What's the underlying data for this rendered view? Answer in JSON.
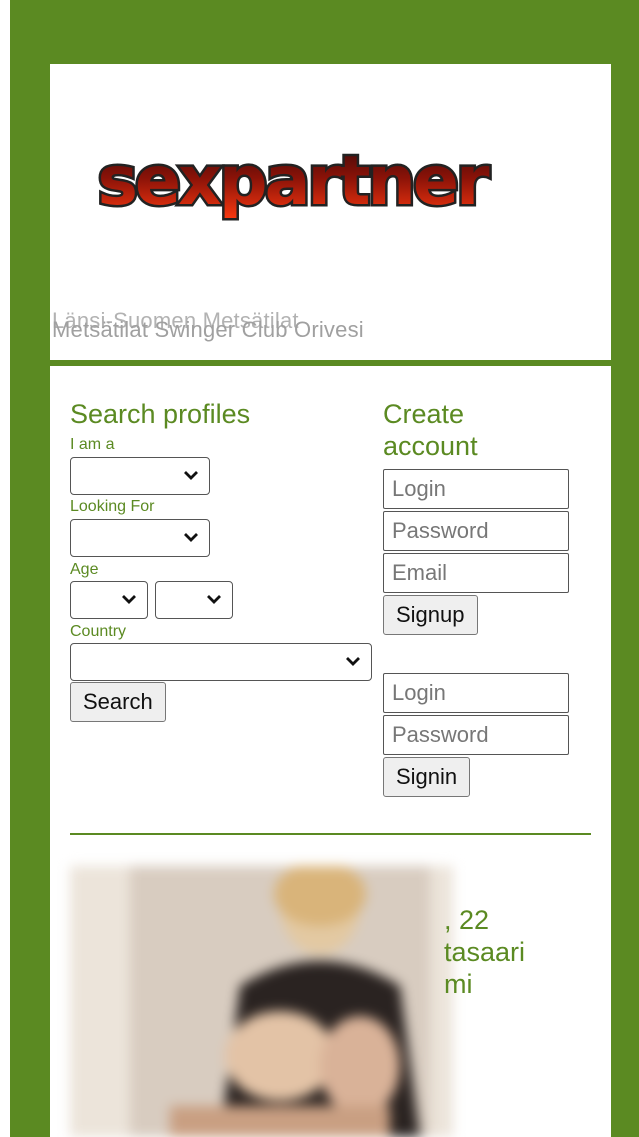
{
  "header": {
    "logo_text": "sexpartner",
    "headline_a": "Länsi-Suomen Metsätilat",
    "headline_b": "Metsätilat Swinger Club Orivesi"
  },
  "search": {
    "title": "Search profiles",
    "iam_label": "I am a",
    "looking_label": "Looking For",
    "age_label": "Age",
    "country_label": "Country",
    "search_button": "Search"
  },
  "signup": {
    "title": "Create account",
    "login_placeholder": "Login",
    "password_placeholder": "Password",
    "email_placeholder": "Email",
    "signup_button": "Signup"
  },
  "signin": {
    "login_placeholder": "Login",
    "password_placeholder": "Password",
    "signin_button": "Signin"
  },
  "featured": {
    "line1": ", 22",
    "line2": "tasaari",
    "line3": "mi"
  },
  "colors": {
    "brand_green": "#5b8a22",
    "logo_red": "#c2180a",
    "logo_dark": "#3a0a0a"
  }
}
